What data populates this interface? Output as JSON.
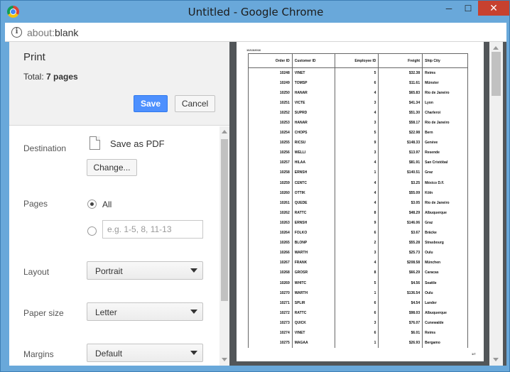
{
  "window": {
    "title": "Untitled - Google Chrome",
    "minimize_label": "─",
    "maximize_label": "☐",
    "close_label": "✕"
  },
  "address_bar": {
    "url_scheme": "about:",
    "url_path": "blank"
  },
  "print_panel": {
    "title": "Print",
    "total_label": "Total:",
    "total_value": "7 pages",
    "save_label": "Save",
    "cancel_label": "Cancel",
    "destination": {
      "label": "Destination",
      "value": "Save as PDF",
      "change_label": "Change..."
    },
    "pages": {
      "label": "Pages",
      "all_label": "All",
      "all_selected": true,
      "custom_placeholder": "e.g. 1-5, 8, 11-13"
    },
    "layout": {
      "label": "Layout",
      "value": "Portrait"
    },
    "paper_size": {
      "label": "Paper size",
      "value": "Letter"
    },
    "margins": {
      "label": "Margins",
      "value": "Default"
    }
  },
  "preview": {
    "page_date": "10/13/2016",
    "page_number": "1/7",
    "columns": [
      "Order ID",
      "Customer ID",
      "Employee ID",
      "Freight",
      "Ship City"
    ],
    "rows": [
      [
        "10248",
        "VINET",
        "5",
        "$32.38",
        "Reims"
      ],
      [
        "10249",
        "TOMSP",
        "6",
        "$11.61",
        "Münster"
      ],
      [
        "10250",
        "HANAR",
        "4",
        "$65.83",
        "Rio de Janeiro"
      ],
      [
        "10251",
        "VICTE",
        "3",
        "$41.34",
        "Lyon"
      ],
      [
        "10252",
        "SUPRD",
        "4",
        "$51.30",
        "Charleroi"
      ],
      [
        "10253",
        "HANAR",
        "3",
        "$58.17",
        "Rio de Janeiro"
      ],
      [
        "10254",
        "CHOPS",
        "5",
        "$22.98",
        "Bern"
      ],
      [
        "10255",
        "RICSU",
        "9",
        "$148.33",
        "Genève"
      ],
      [
        "10256",
        "WELLI",
        "3",
        "$13.97",
        "Resende"
      ],
      [
        "10257",
        "HILAA",
        "4",
        "$81.91",
        "San Cristóbal"
      ],
      [
        "10258",
        "ERNSH",
        "1",
        "$140.51",
        "Graz"
      ],
      [
        "10259",
        "CENTC",
        "4",
        "$3.25",
        "México D.F."
      ],
      [
        "10260",
        "OTTIK",
        "4",
        "$55.09",
        "Köln"
      ],
      [
        "10261",
        "QUEDE",
        "4",
        "$3.05",
        "Rio de Janeiro"
      ],
      [
        "10262",
        "RATTC",
        "8",
        "$48.29",
        "Albuquerque"
      ],
      [
        "10263",
        "ERNSH",
        "9",
        "$146.06",
        "Graz"
      ],
      [
        "10264",
        "FOLKO",
        "6",
        "$3.67",
        "Bräcke"
      ],
      [
        "10265",
        "BLONP",
        "2",
        "$55.28",
        "Strasbourg"
      ],
      [
        "10266",
        "WARTH",
        "3",
        "$25.73",
        "Oulu"
      ],
      [
        "10267",
        "FRANK",
        "4",
        "$208.58",
        "München"
      ],
      [
        "10268",
        "GROSR",
        "8",
        "$66.29",
        "Caracas"
      ],
      [
        "10269",
        "WHITC",
        "5",
        "$4.56",
        "Seattle"
      ],
      [
        "10270",
        "WARTH",
        "1",
        "$136.54",
        "Oulu"
      ],
      [
        "10271",
        "SPLIR",
        "6",
        "$4.54",
        "Lander"
      ],
      [
        "10272",
        "RATTC",
        "6",
        "$98.03",
        "Albuquerque"
      ],
      [
        "10273",
        "QUICK",
        "3",
        "$76.07",
        "Cunewalde"
      ],
      [
        "10274",
        "VINET",
        "6",
        "$6.01",
        "Reims"
      ],
      [
        "10275",
        "MAGAA",
        "1",
        "$26.93",
        "Bergamo"
      ]
    ]
  }
}
